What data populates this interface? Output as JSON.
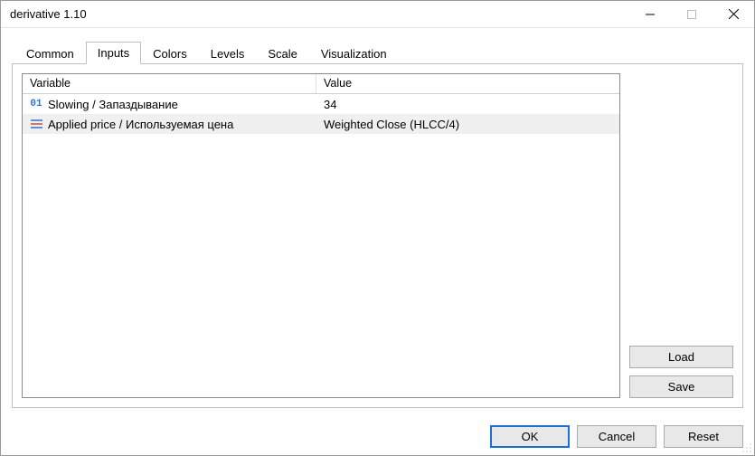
{
  "window": {
    "title": "derivative 1.10"
  },
  "tabs": [
    {
      "label": "Common",
      "active": false
    },
    {
      "label": "Inputs",
      "active": true
    },
    {
      "label": "Colors",
      "active": false
    },
    {
      "label": "Levels",
      "active": false
    },
    {
      "label": "Scale",
      "active": false
    },
    {
      "label": "Visualization",
      "active": false
    }
  ],
  "table": {
    "headers": {
      "variable": "Variable",
      "value": "Value"
    },
    "rows": [
      {
        "icon": "number",
        "variable": "Slowing / Запаздывание",
        "value": "34",
        "selected": false
      },
      {
        "icon": "enum",
        "variable": "Applied price / Используемая цена",
        "value": "Weighted Close (HLCC/4)",
        "selected": true
      }
    ]
  },
  "side_buttons": {
    "load": "Load",
    "save": "Save"
  },
  "bottom_buttons": {
    "ok": "OK",
    "cancel": "Cancel",
    "reset": "Reset"
  }
}
